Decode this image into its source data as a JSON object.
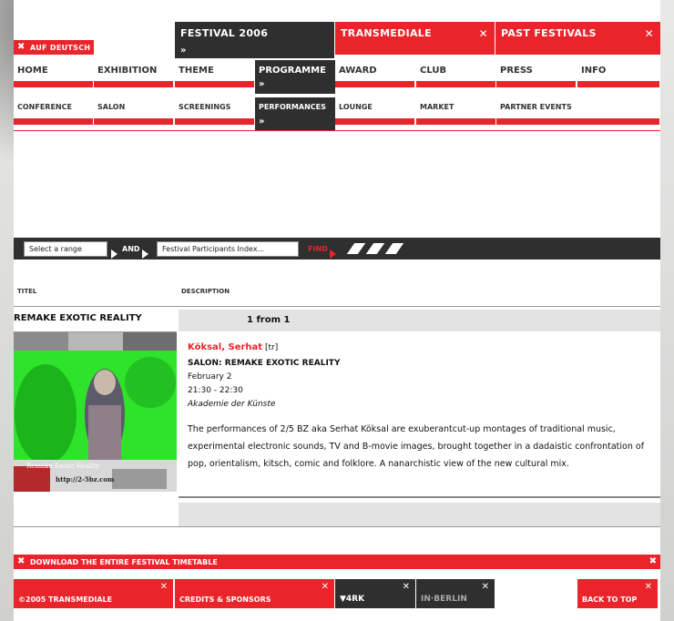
{
  "header": {
    "lang_link": "AUF DEUTSCH",
    "tabs": [
      "FESTIVAL 2006",
      "TRANSMEDIALE",
      "PAST FESTIVALS"
    ]
  },
  "nav": {
    "main": [
      "HOME",
      "EXHIBITION",
      "THEME",
      "PROGRAMME",
      "AWARD",
      "CLUB",
      "PRESS",
      "INFO"
    ],
    "sub": [
      "CONFERENCE",
      "SALON",
      "SCREENINGS",
      "PERFORMANCES",
      "LOUNGE",
      "MARKET",
      "PARTNER EVENTS"
    ]
  },
  "search": {
    "range_label": "Select a range",
    "and_label": "AND",
    "index_label": "Festival Participants Index...",
    "find_label": "FIND"
  },
  "list": {
    "col_title": "TITEL",
    "col_desc": "DESCRIPTION",
    "entry_title": "REMAKE EXOTIC REALITY",
    "pager": "1 from 1"
  },
  "image": {
    "caption": "Remake Exotic Reality",
    "url": "http://2-5bz.com"
  },
  "event": {
    "artist": "Köksal, Serhat",
    "country": "[tr]",
    "title": "SALON: REMAKE EXOTIC REALITY",
    "date": "February 2",
    "time": "21:30 - 22:30",
    "venue": "Akademie der Künste",
    "description": "The performances of 2/5 BZ aka Serhat Köksal are exuberantcut-up montages of traditional music, experimental electronic sounds, TV and B-movie images, brought together in a dadaistic confrontation of pop, orientalism, kitsch, comic and folklore. A nanarchistic view of the new cultural mix."
  },
  "footer": {
    "download": "DOWNLOAD THE ENTIRE FESTIVAL TIMETABLE",
    "copyright": "©2005 TRANSMEDIALE",
    "credits": "CREDITS & SPONSORS",
    "logo1": "▼4RK",
    "logo2": "IN·BERLIN",
    "back_to_top": "BACK TO TOP"
  },
  "colors": {
    "accent": "#e9242b",
    "dark": "#2f2f2f",
    "panel": "#e3e3e3"
  }
}
